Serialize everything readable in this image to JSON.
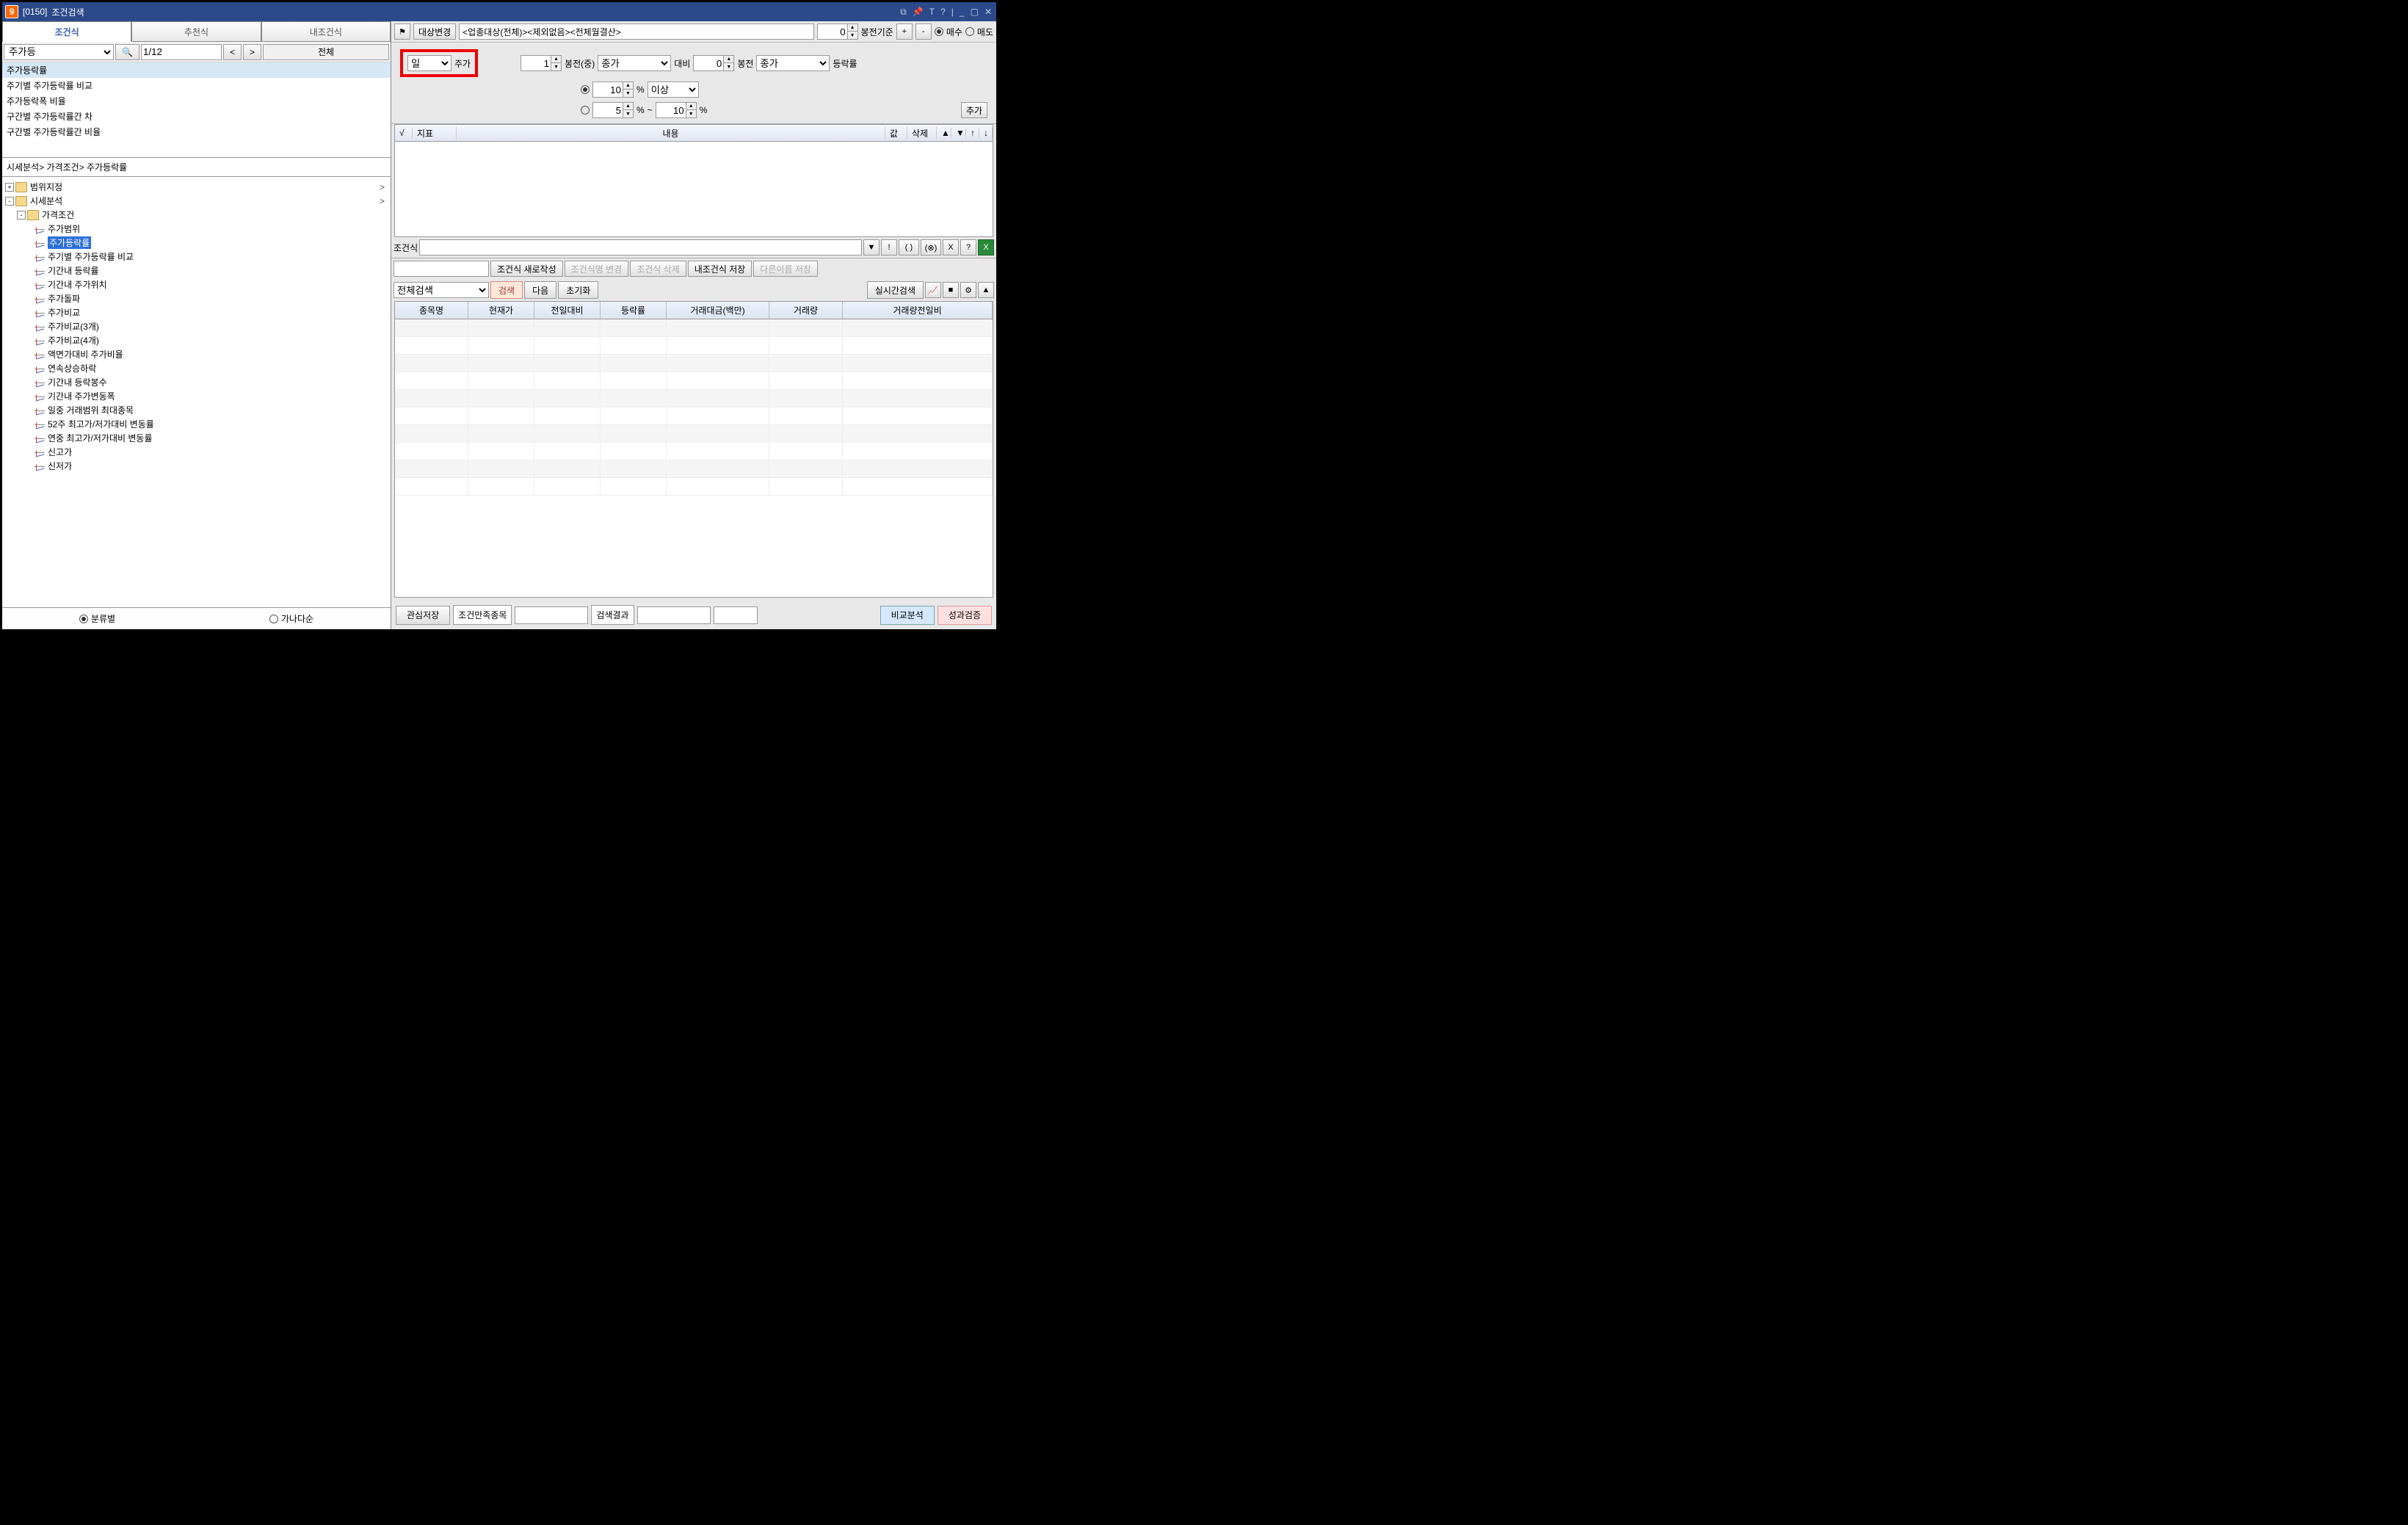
{
  "window": {
    "code": "[0150]",
    "title": "조건검색"
  },
  "left": {
    "tabs": [
      "조건식",
      "추천식",
      "내조건식"
    ],
    "active_tab": 0,
    "filter_value": "주가등",
    "page": "1/12",
    "prev": "<",
    "next": ">",
    "all": "전체",
    "results": [
      "주가등락률",
      "주기별 주가등락률 비교",
      "주가등락폭 비율",
      "구간별 주가등락률간 차",
      "구간별 주가등락률간 비율"
    ],
    "breadcrumb": "시세분석> 가격조건> 주가등락률",
    "tree": [
      {
        "lvl": 0,
        "type": "folder",
        "toggle": "+",
        "label": "범위지정",
        "arrow": ">"
      },
      {
        "lvl": 0,
        "type": "folder",
        "toggle": "-",
        "label": "시세분석",
        "arrow": ">"
      },
      {
        "lvl": 1,
        "type": "folder",
        "toggle": "-",
        "label": "가격조건"
      },
      {
        "lvl": 2,
        "type": "leaf",
        "label": "주가범위"
      },
      {
        "lvl": 2,
        "type": "leaf",
        "label": "주가등락률",
        "selected": true
      },
      {
        "lvl": 2,
        "type": "leaf",
        "label": "주기별 주가등락률 비교"
      },
      {
        "lvl": 2,
        "type": "leaf",
        "label": "기간내 등락률"
      },
      {
        "lvl": 2,
        "type": "leaf",
        "label": "기간내 주가위치"
      },
      {
        "lvl": 2,
        "type": "leaf",
        "label": "주가돌파"
      },
      {
        "lvl": 2,
        "type": "leaf",
        "label": "주가비교"
      },
      {
        "lvl": 2,
        "type": "leaf",
        "label": "주가비교(3개)"
      },
      {
        "lvl": 2,
        "type": "leaf",
        "label": "주가비교(4개)"
      },
      {
        "lvl": 2,
        "type": "leaf",
        "label": "액면가대비 주가비율"
      },
      {
        "lvl": 2,
        "type": "leaf",
        "label": "연속상승하락"
      },
      {
        "lvl": 2,
        "type": "leaf",
        "label": "기간내 등락봉수"
      },
      {
        "lvl": 2,
        "type": "leaf",
        "label": "기간내 주가변동폭"
      },
      {
        "lvl": 2,
        "type": "leaf",
        "label": "일중 거래범위 최대종목"
      },
      {
        "lvl": 2,
        "type": "leaf",
        "label": "52주 최고가/저가대비 변동률"
      },
      {
        "lvl": 2,
        "type": "leaf",
        "label": "연중 최고가/저가대비 변동률"
      },
      {
        "lvl": 2,
        "type": "leaf",
        "label": "신고가"
      },
      {
        "lvl": 2,
        "type": "leaf",
        "label": "신저가"
      }
    ],
    "sort_by_class": "분류별",
    "sort_by_name": "가나다순"
  },
  "right": {
    "target_change": "대상변경",
    "target_desc": "<업종대상(전체)><제외없음><전체월결산>",
    "spin_top": "0",
    "bong_base": "봉전기준",
    "plus": "+",
    "minus": "-",
    "buy": "매수",
    "sell": "매도",
    "period_sel": "일",
    "period_suffix": "주가",
    "p1": {
      "val": "1",
      "label": "봉전(중)"
    },
    "price_type": "종가",
    "vs": "대비",
    "p2": {
      "val": "0",
      "label": "봉전"
    },
    "price_type2": "종가",
    "rate_label": "등락률",
    "pct1": "10",
    "pct_unit": "%",
    "cmp": "이상",
    "pct2": "5",
    "pct_tilde": "~",
    "pct3": "10",
    "add": "추가",
    "cond_headers": {
      "check": "√",
      "ind": "지표",
      "desc": "내용",
      "val": "값",
      "del": "삭제",
      "up": "▲",
      "dn": "▼",
      "u": "↑",
      "d": "↓"
    },
    "formula_label": "조건식",
    "formula_buttons": [
      "▼",
      "!",
      "( )",
      "(⊗)",
      "X",
      "?"
    ],
    "actions": {
      "new": "조건식 새로작성",
      "rename": "조건식명 변경",
      "delete": "조건식 삭제",
      "savemy": "내조건식 저장",
      "saveas": "다른이름 저장"
    },
    "search": {
      "scope": "전체검색",
      "go": "검색",
      "next": "다음",
      "reset": "초기화",
      "realtime": "실시간검색"
    },
    "grid_headers": [
      "종목명",
      "현재가",
      "전일대비",
      "등락률",
      "거래대금(백만)",
      "거래량",
      "거래량전일비"
    ],
    "bottom": {
      "fav": "관심저장",
      "cond_stock": "조건만족종목",
      "result": "검색결과",
      "compare": "비교분석",
      "perf": "성과검증"
    }
  }
}
